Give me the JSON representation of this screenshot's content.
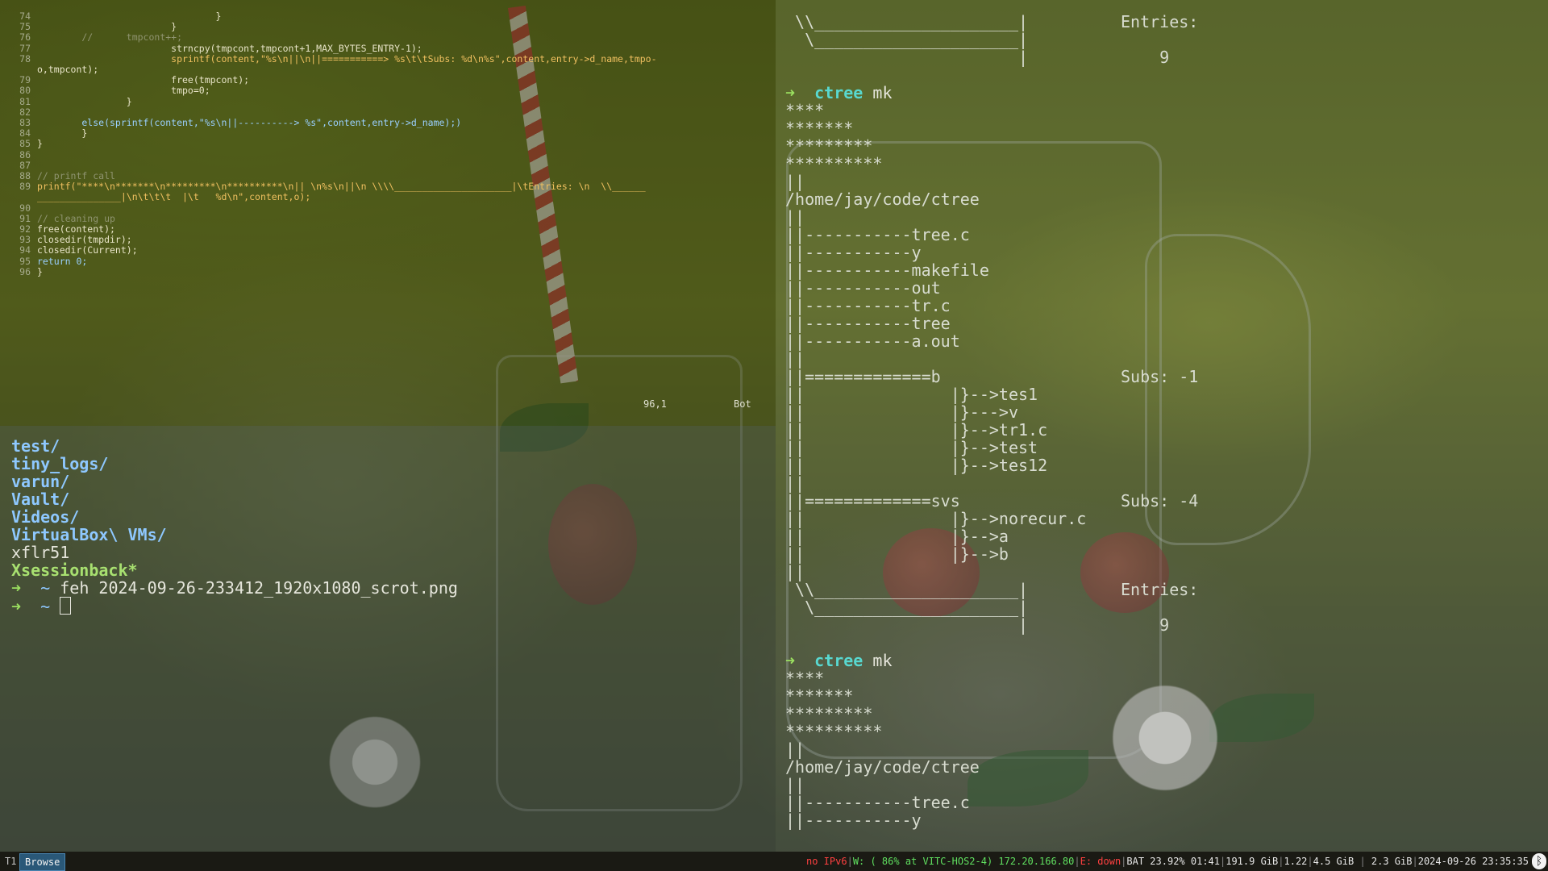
{
  "editor": {
    "lines": [
      {
        "n": "74",
        "t": "                                }"
      },
      {
        "n": "75",
        "t": "                        }"
      },
      {
        "n": "76",
        "t": "        //      tmpcont++;"
      },
      {
        "n": "77",
        "t": "                        strncpy(tmpcont,tmpcont+1,MAX_BYTES_ENTRY-1);"
      },
      {
        "n": "78",
        "t": "                        sprintf(content,\"%s\\n||\\n||===========> %s\\t\\tSubs: %d\\n%s\",content,entry->d_name,tmpo-"
      },
      {
        "n": "",
        "t": "o,tmpcont);"
      },
      {
        "n": "79",
        "t": "                        free(tmpcont);"
      },
      {
        "n": "80",
        "t": "                        tmpo=0;"
      },
      {
        "n": "81",
        "t": "                }"
      },
      {
        "n": "82",
        "t": ""
      },
      {
        "n": "83",
        "t": "        else(sprintf(content,\"%s\\n||----------> %s\",content,entry->d_name);)"
      },
      {
        "n": "84",
        "t": "        }"
      },
      {
        "n": "85",
        "t": "}"
      },
      {
        "n": "86",
        "t": ""
      },
      {
        "n": "87",
        "t": ""
      },
      {
        "n": "88",
        "t": "// printf call"
      },
      {
        "n": "89",
        "t": "printf(\"****\\n*******\\n*********\\n**********\\n|| \\n%s\\n||\\n \\\\\\\\_____________________|\\tEntries: \\n  \\\\______"
      },
      {
        "n": "",
        "t": "_______________|\\n\\t\\t\\t  |\\t   %d\\n\",content,o);"
      },
      {
        "n": "90",
        "t": ""
      },
      {
        "n": "91",
        "t": "// cleaning up"
      },
      {
        "n": "92",
        "t": "free(content);"
      },
      {
        "n": "93",
        "t": "closedir(tmpdir);"
      },
      {
        "n": "94",
        "t": "closedir(Current);"
      },
      {
        "n": "95",
        "t": "return 0;"
      },
      {
        "n": "96",
        "t": "}"
      }
    ],
    "status_position": "96,1",
    "status_scroll": "Bot"
  },
  "left_terminal": {
    "dirs": [
      "test/",
      "tiny_logs/",
      "varun/",
      "Vault/",
      "Videos/",
      "VirtualBox\\ VMs/"
    ],
    "file": "xflr51",
    "exec_file": "Xsessionback*",
    "prompt_arrow": "➜",
    "prompt_dir": "~",
    "last_command": "feh 2024-09-26-233412_1920x1080_scrot.png"
  },
  "right_terminal": {
    "lines": [
      {
        "k": "plain",
        "t": " \\\\_____________________|"
      },
      {
        "k": "plain",
        "t": "  \\_____________________|"
      },
      {
        "k": "plain",
        "t": "                        |"
      },
      {
        "k": "blank",
        "t": ""
      },
      {
        "k": "prompt",
        "arrow": "➜",
        "cmd": "ctree",
        "arg": "mk"
      },
      {
        "k": "plain",
        "t": "****"
      },
      {
        "k": "plain",
        "t": "*******"
      },
      {
        "k": "plain",
        "t": "*********"
      },
      {
        "k": "plain",
        "t": "**********"
      },
      {
        "k": "plain",
        "t": "||"
      },
      {
        "k": "plain",
        "t": "/home/jay/code/ctree"
      },
      {
        "k": "plain",
        "t": "||"
      },
      {
        "k": "plain",
        "t": "||-----------tree.c"
      },
      {
        "k": "plain",
        "t": "||-----------y"
      },
      {
        "k": "plain",
        "t": "||-----------makefile"
      },
      {
        "k": "plain",
        "t": "||-----------out"
      },
      {
        "k": "plain",
        "t": "||-----------tr.c"
      },
      {
        "k": "plain",
        "t": "||-----------tree"
      },
      {
        "k": "plain",
        "t": "||-----------a.out"
      },
      {
        "k": "plain",
        "t": "||"
      },
      {
        "k": "plain",
        "t": "||=============b"
      },
      {
        "k": "plain",
        "t": "||               |}-->tes1"
      },
      {
        "k": "plain",
        "t": "||               |}--->v"
      },
      {
        "k": "plain",
        "t": "||               |}-->tr1.c"
      },
      {
        "k": "plain",
        "t": "||               |}-->test"
      },
      {
        "k": "plain",
        "t": "||               |}-->tes12"
      },
      {
        "k": "plain",
        "t": "||"
      },
      {
        "k": "plain",
        "t": "||=============svs"
      },
      {
        "k": "plain",
        "t": "||               |}-->norecur.c"
      },
      {
        "k": "plain",
        "t": "||               |}-->a"
      },
      {
        "k": "plain",
        "t": "||               |}-->b"
      },
      {
        "k": "plain",
        "t": "||"
      },
      {
        "k": "plain",
        "t": " \\\\_____________________|"
      },
      {
        "k": "plain",
        "t": "  \\_____________________|"
      },
      {
        "k": "plain",
        "t": "                        |"
      },
      {
        "k": "blank",
        "t": ""
      },
      {
        "k": "prompt",
        "arrow": "➜",
        "cmd": "ctree",
        "arg": "mk"
      },
      {
        "k": "plain",
        "t": "****"
      },
      {
        "k": "plain",
        "t": "*******"
      },
      {
        "k": "plain",
        "t": "*********"
      },
      {
        "k": "plain",
        "t": "**********"
      },
      {
        "k": "plain",
        "t": "||"
      },
      {
        "k": "plain",
        "t": "/home/jay/code/ctree"
      },
      {
        "k": "plain",
        "t": "||"
      },
      {
        "k": "plain",
        "t": "||-----------tree.c"
      },
      {
        "k": "plain",
        "t": "||-----------y"
      }
    ],
    "col2": [
      {
        "row": 0,
        "t": "Entries:"
      },
      {
        "row": 2,
        "t": "    9"
      },
      {
        "row": 20,
        "t": "Subs: -1"
      },
      {
        "row": 27,
        "t": "Subs: -4"
      },
      {
        "row": 32,
        "t": "Entries:"
      },
      {
        "row": 34,
        "t": "    9"
      }
    ]
  },
  "bar": {
    "ws1": "T1",
    "ws2": "Browse",
    "ipv6": "no IPv6",
    "wifi": "W: ( 86% at VITC-HOS2-4) 172.20.166.80",
    "eth": "E: down",
    "battery": "BAT 23.92% 01:41",
    "disk": "191.9 GiB",
    "load": "1.22",
    "mem1": "4.5 GiB",
    "mem2": "2.3 GiB",
    "datetime": "2024-09-26 23:35:35",
    "bt_icon": "bluetooth-icon"
  },
  "colors": {
    "dir": "#8ec8ff",
    "arrow": "#9be060",
    "cmd": "#58d8d0",
    "exec": "#a8e070"
  }
}
